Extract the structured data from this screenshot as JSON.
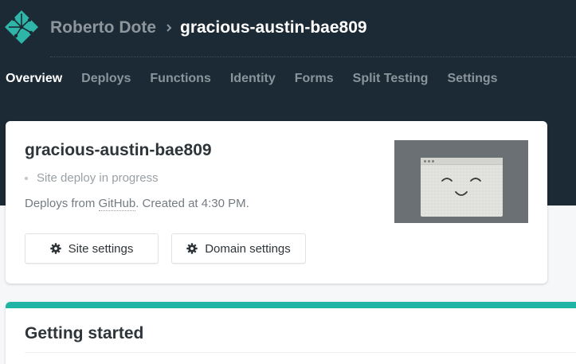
{
  "header": {
    "team_name": "Roberto Dote",
    "site_name": "gracious-austin-bae809",
    "logo_icon": "netlify-logo-icon",
    "separator_icon": "chevron-right-icon"
  },
  "nav": {
    "tabs": [
      {
        "label": "Overview",
        "active": true
      },
      {
        "label": "Deploys",
        "active": false
      },
      {
        "label": "Functions",
        "active": false
      },
      {
        "label": "Identity",
        "active": false
      },
      {
        "label": "Forms",
        "active": false
      },
      {
        "label": "Split Testing",
        "active": false
      },
      {
        "label": "Settings",
        "active": false
      }
    ]
  },
  "site_card": {
    "title": "gracious-austin-bae809",
    "status": "Site deploy in progress",
    "deploy_prefix": "Deploys from ",
    "repo_provider": "GitHub",
    "deploy_suffix": ". Created at 4:30 PM.",
    "buttons": {
      "site_settings": "Site settings",
      "domain_settings": "Domain settings",
      "icon": "gear-icon"
    },
    "preview_icon": "smiling-browser-window-icon"
  },
  "getting_started": {
    "title": "Getting started"
  },
  "colors": {
    "header_bg": "#1c2a35",
    "accent": "#20b4a5",
    "page_bg": "#f5f7f9"
  }
}
